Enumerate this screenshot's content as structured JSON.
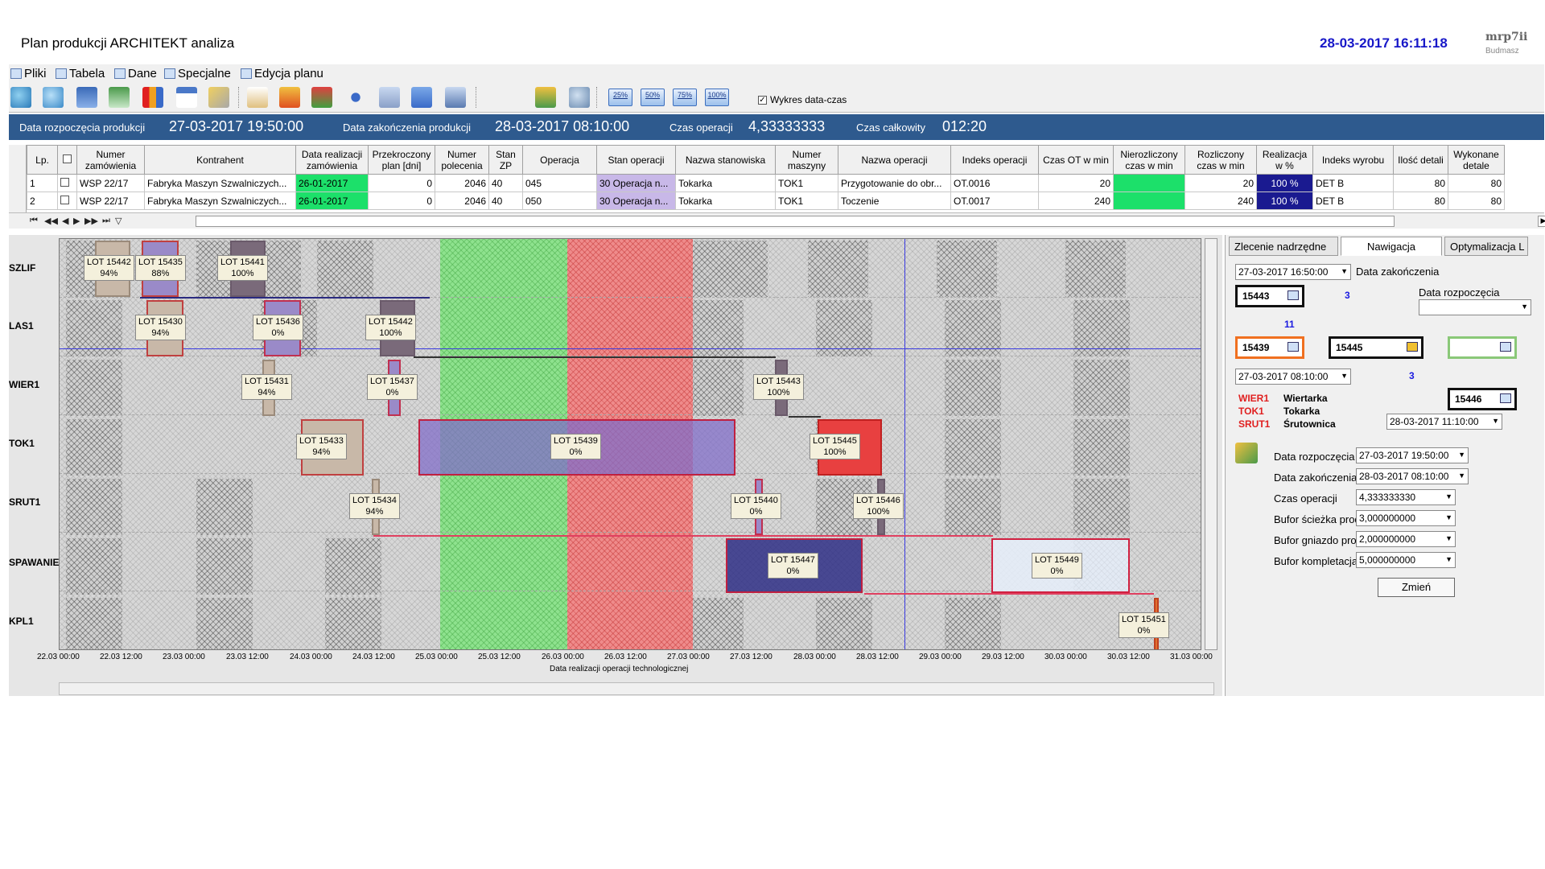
{
  "app": {
    "title": "Plan produkcji ARCHITEKT analiza",
    "datetime": "28-03-2017 16:11:18",
    "brand": "mrp7ii",
    "brand_sub": "Budmasz"
  },
  "menu": [
    {
      "label": "Pliki",
      "icon": "files-icon"
    },
    {
      "label": "Tabela",
      "icon": "table-icon"
    },
    {
      "label": "Dane",
      "icon": "data-icon"
    },
    {
      "label": "Specjalne",
      "icon": "special-icon"
    },
    {
      "label": "Edycja planu",
      "icon": "edit-plan-icon"
    }
  ],
  "toolbar": {
    "zoom": [
      "25%",
      "50%",
      "75%",
      "100%"
    ],
    "chart_checkbox_label": "Wykres data-czas",
    "chart_checkbox_checked": true
  },
  "info": {
    "start_label": "Data rozpoczęcia produkcji",
    "start_value": "27-03-2017 19:50:00",
    "end_label": "Data zakończenia produkcji",
    "end_value": "28-03-2017 08:10:00",
    "op_time_label": "Czas operacji",
    "op_time_value": "4,33333333",
    "total_time_label": "Czas całkowity",
    "total_time_value": "012:20"
  },
  "grid": {
    "columns": [
      "Lp.",
      "",
      "Numer zamówienia",
      "Kontrahent",
      "Data realizacji zamówienia",
      "Przekroczony plan [dni]",
      "Numer polecenia",
      "Stan ZP",
      "Operacja",
      "Stan operacji",
      "Nazwa stanowiska",
      "Numer maszyny",
      "Nazwa operacji",
      "Indeks operacji",
      "Czas OT w min",
      "Nierozliczony czas w min",
      "Rozliczony czas w min",
      "Realizacja w %",
      "Indeks wyrobu",
      "Ilość detali",
      "Wykonane detale"
    ],
    "rows": [
      [
        "1",
        "",
        "WSP 22/17",
        "Fabryka Maszyn Szwalniczych...",
        "26-01-2017",
        "0",
        "2046",
        "40",
        "045",
        "30 Operacja n...",
        "Tokarka",
        "TOK1",
        "Przygotowanie do obr...",
        "OT.0016",
        "20",
        "",
        "20",
        "100 %",
        "DET B",
        "80",
        "80"
      ],
      [
        "2",
        "",
        "WSP 22/17",
        "Fabryka Maszyn Szwalniczych...",
        "26-01-2017",
        "0",
        "2046",
        "40",
        "050",
        "30 Operacja n...",
        "Tokarka",
        "TOK1",
        "Toczenie",
        "OT.0017",
        "240",
        "",
        "240",
        "100 %",
        "DET B",
        "80",
        "80"
      ]
    ]
  },
  "gantt": {
    "resources": [
      "SZLIF",
      "LAS1",
      "WIER1",
      "TOK1",
      "SRUT1",
      "SPAWANIE",
      "KPL1"
    ],
    "ticks": [
      "22.03 00:00",
      "22.03 12:00",
      "23.03 00:00",
      "23.03 12:00",
      "24.03 00:00",
      "24.03 12:00",
      "25.03 00:00",
      "25.03 12:00",
      "26.03 00:00",
      "26.03 12:00",
      "27.03 00:00",
      "27.03 12:00",
      "28.03 00:00",
      "28.03 12:00",
      "29.03 00:00",
      "29.03 12:00",
      "30.03 00:00",
      "30.03 12:00",
      "31.03 00:00"
    ],
    "x_title": "Data realizacji operacji technologicznej",
    "lots": [
      {
        "name": "LOT 15442",
        "pct": "94%"
      },
      {
        "name": "LOT 15435",
        "pct": "88%"
      },
      {
        "name": "LOT 15441",
        "pct": "100%"
      },
      {
        "name": "LOT 15430",
        "pct": "94%"
      },
      {
        "name": "LOT 15436",
        "pct": "0%"
      },
      {
        "name": "LOT 15442",
        "pct": "100%"
      },
      {
        "name": "LOT 15431",
        "pct": "94%"
      },
      {
        "name": "LOT 15437",
        "pct": "0%"
      },
      {
        "name": "LOT 15443",
        "pct": "100%"
      },
      {
        "name": "LOT 15433",
        "pct": "94%"
      },
      {
        "name": "LOT 15439",
        "pct": "0%"
      },
      {
        "name": "LOT 15445",
        "pct": "100%"
      },
      {
        "name": "LOT 15434",
        "pct": "94%"
      },
      {
        "name": "LOT 15440",
        "pct": "0%"
      },
      {
        "name": "LOT 15446",
        "pct": "100%"
      },
      {
        "name": "LOT 15447",
        "pct": "0%"
      },
      {
        "name": "LOT 15449",
        "pct": "0%"
      },
      {
        "name": "LOT 15451",
        "pct": "0%"
      }
    ]
  },
  "panel": {
    "tabs": [
      "Zlecenie nadrzędne",
      "Nawigacja",
      "Optymalizacja L"
    ],
    "end_dd": "27-03-2017 16:50:00",
    "end_lbl": "Data zakończenia",
    "start_lbl": "Data rozpoczęcia",
    "start_dd": "",
    "mid_dd": "27-03-2017 08:10:00",
    "right_dd": "28-03-2017 11:10:00",
    "nodes": {
      "a": "15443",
      "b": "15439",
      "c": "15445",
      "d": "",
      "e": "15446"
    },
    "num_3a": "3",
    "num_11": "11",
    "num_3b": "3",
    "legend": [
      {
        "code": "WIER1",
        "name": "Wiertarka"
      },
      {
        "code": "TOK1",
        "name": "Tokarka"
      },
      {
        "code": "SRUT1",
        "name": "Śrutownica"
      }
    ],
    "fields": [
      {
        "label": "Data rozpoczęcia",
        "value": "27-03-2017 19:50:00"
      },
      {
        "label": "Data zakończenia",
        "value": "28-03-2017 08:10:00"
      },
      {
        "label": "Czas operacji",
        "value": "4,333333330"
      },
      {
        "label": "Bufor ścieżka prod.",
        "value": "3,000000000"
      },
      {
        "label": "Bufor gniazdo prod.",
        "value": "2,000000000"
      },
      {
        "label": "Bufor kompletacja",
        "value": "5,000000000"
      }
    ],
    "change_btn": "Zmień"
  },
  "colors": {
    "accent": "#2e5a8e",
    "green": "#1ce06a",
    "navy": "#1a1a90"
  }
}
